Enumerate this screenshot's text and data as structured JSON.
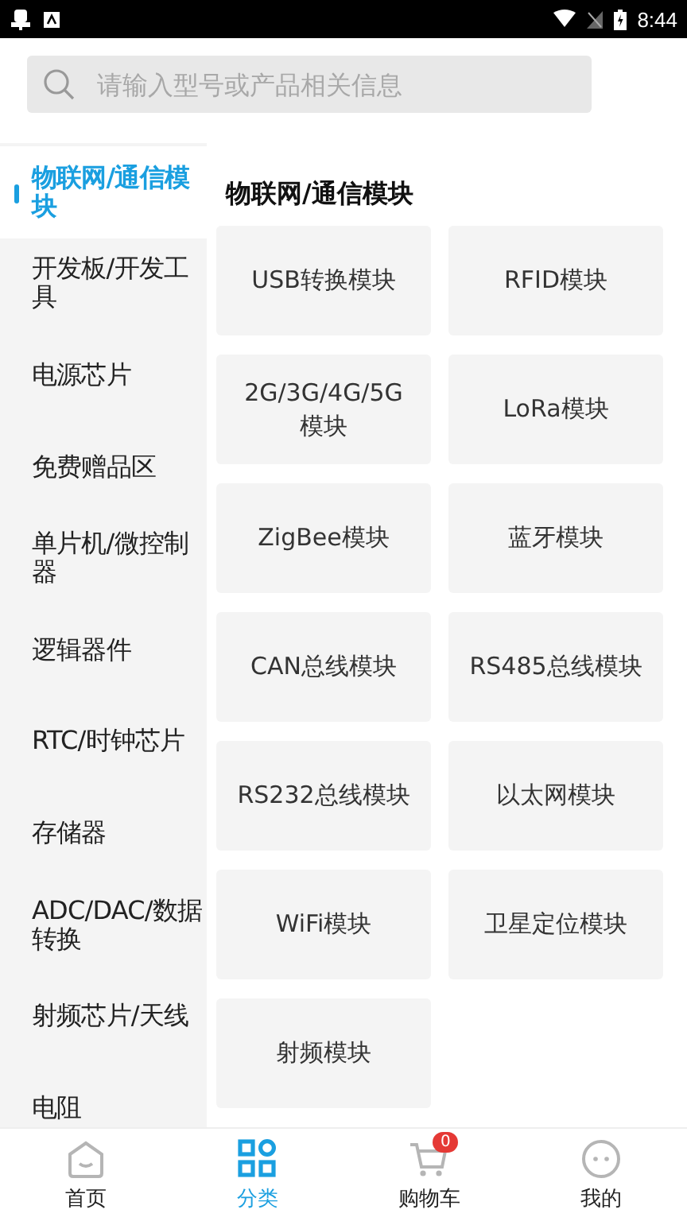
{
  "status_bar": {
    "time": "8:44"
  },
  "search": {
    "placeholder": "请输入型号或产品相关信息"
  },
  "sidebar": {
    "items": [
      {
        "label": "物联网/通信模块",
        "selected": true
      },
      {
        "label": "开发板/开发工具",
        "selected": false
      },
      {
        "label": "电源芯片",
        "selected": false
      },
      {
        "label": "免费赠品区",
        "selected": false
      },
      {
        "label": "单片机/微控制器",
        "selected": false
      },
      {
        "label": "逻辑器件",
        "selected": false
      },
      {
        "label": "RTC/时钟芯片",
        "selected": false
      },
      {
        "label": "存储器",
        "selected": false
      },
      {
        "label": "ADC/DAC/数据转换",
        "selected": false
      },
      {
        "label": "射频芯片/天线",
        "selected": false
      },
      {
        "label": "电阻",
        "selected": false
      }
    ]
  },
  "content": {
    "title": "物联网/通信模块",
    "items": [
      "USB转换模块",
      "RFID模块",
      "2G/3G/4G/5G模块",
      "LoRa模块",
      "ZigBee模块",
      "蓝牙模块",
      "CAN总线模块",
      "RS485总线模块",
      "RS232总线模块",
      "以太网模块",
      "WiFi模块",
      "卫星定位模块",
      "射频模块"
    ]
  },
  "bottom_nav": [
    {
      "label": "首页",
      "kind": "home",
      "selected": false
    },
    {
      "label": "分类",
      "kind": "category",
      "selected": true
    },
    {
      "label": "购物车",
      "kind": "cart",
      "selected": false,
      "badge": "0"
    },
    {
      "label": "我的",
      "kind": "profile",
      "selected": false
    }
  ]
}
